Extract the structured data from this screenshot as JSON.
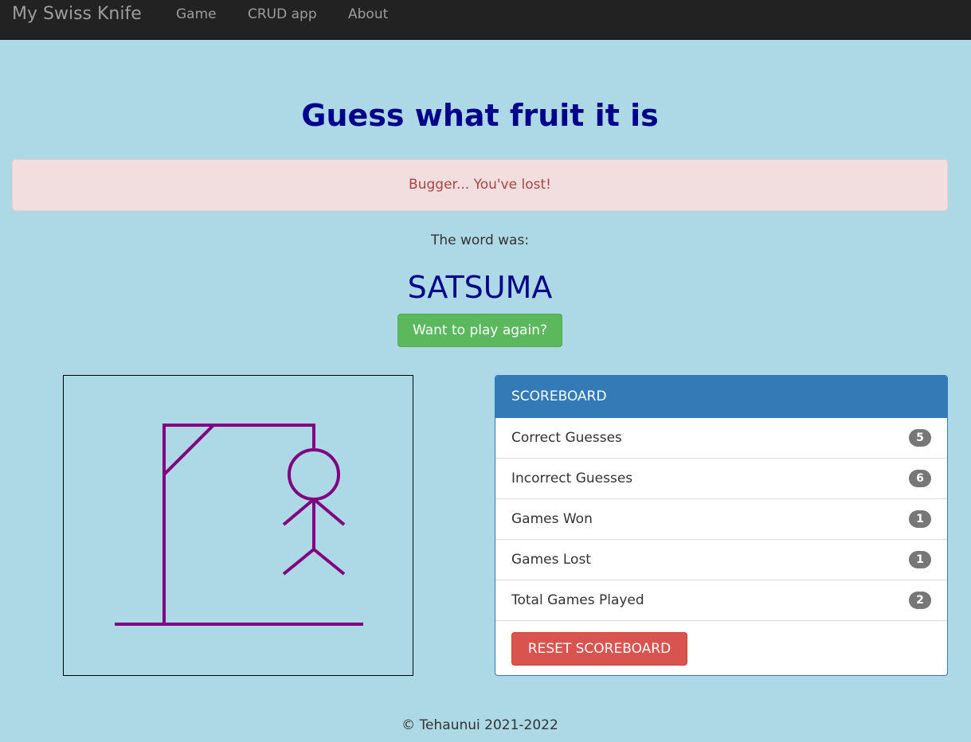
{
  "navbar": {
    "brand": "My Swiss Knife",
    "links": [
      "Game",
      "CRUD app",
      "About"
    ]
  },
  "game": {
    "title": "Guess what fruit it is",
    "alert": "Bugger... You've lost!",
    "word_label": "The word was:",
    "word": "SATSUMA",
    "play_again": "Want to play again?"
  },
  "scoreboard": {
    "heading": "SCOREBOARD",
    "rows": [
      {
        "label": "Correct Guesses",
        "value": "5"
      },
      {
        "label": "Incorrect Guesses",
        "value": "6"
      },
      {
        "label": "Games Won",
        "value": "1"
      },
      {
        "label": "Games Lost",
        "value": "1"
      },
      {
        "label": "Total Games Played",
        "value": "2"
      }
    ],
    "reset": "RESET SCOREBOARD"
  },
  "footer": "© Tehaunui 2021-2022",
  "colors": {
    "background": "#add8e6",
    "title": "#00008b",
    "hangman": "#800080",
    "success": "#5cb85c",
    "danger": "#d9534f",
    "primary": "#337ab7"
  }
}
